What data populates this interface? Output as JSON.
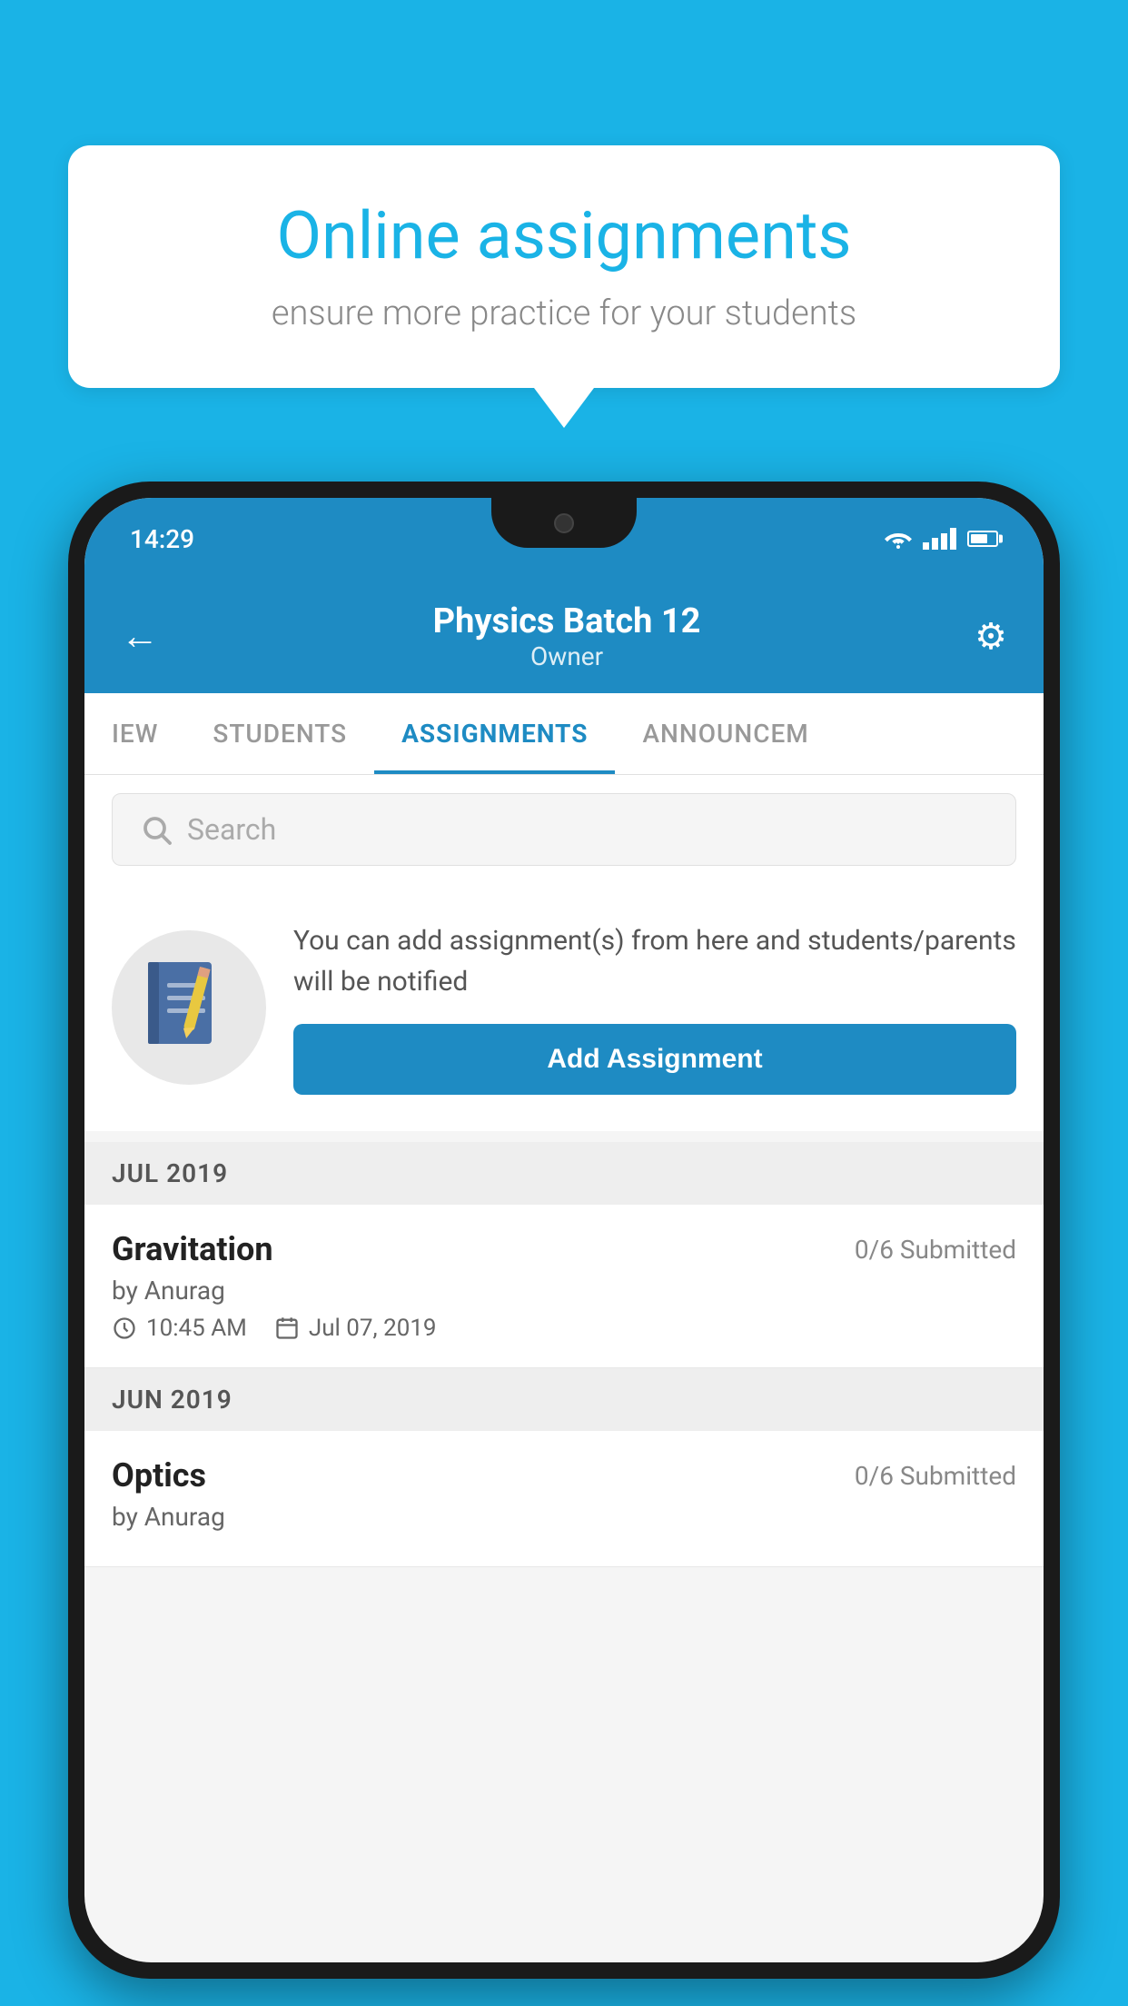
{
  "background_color": "#1ab3e6",
  "speech_bubble": {
    "title": "Online assignments",
    "subtitle": "ensure more practice for your students"
  },
  "phone": {
    "status_bar": {
      "time": "14:29",
      "wifi": true,
      "signal": true,
      "battery": true
    },
    "header": {
      "back_label": "←",
      "title": "Physics Batch 12",
      "subtitle": "Owner",
      "settings_label": "⚙"
    },
    "tabs": [
      {
        "label": "IEW",
        "active": false
      },
      {
        "label": "STUDENTS",
        "active": false
      },
      {
        "label": "ASSIGNMENTS",
        "active": true
      },
      {
        "label": "ANNOUNCEM",
        "active": false
      }
    ],
    "search": {
      "placeholder": "Search"
    },
    "promo": {
      "icon": "📓",
      "description": "You can add assignment(s) from here and students/parents will be notified",
      "button_label": "Add Assignment"
    },
    "sections": [
      {
        "month_label": "JUL 2019",
        "assignments": [
          {
            "name": "Gravitation",
            "status": "0/6 Submitted",
            "author": "by Anurag",
            "time": "10:45 AM",
            "date": "Jul 07, 2019"
          }
        ]
      },
      {
        "month_label": "JUN 2019",
        "assignments": [
          {
            "name": "Optics",
            "status": "0/6 Submitted",
            "author": "by Anurag",
            "time": "",
            "date": ""
          }
        ]
      }
    ]
  }
}
